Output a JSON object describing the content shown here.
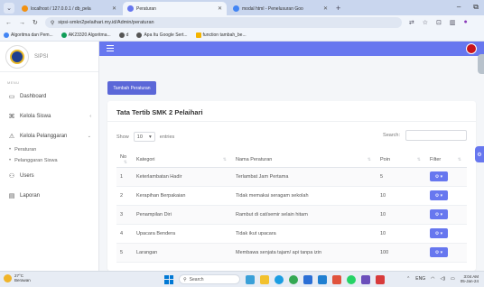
{
  "browser": {
    "tabs": [
      {
        "title": "localhost / 127.0.0.1 / db_pela",
        "favicon_color": "#f29111",
        "active": false
      },
      {
        "title": "Peraturan",
        "favicon_color": "#6777ef",
        "active": true
      },
      {
        "title": "modal html - Penelusuran Goo",
        "favicon_color": "#4285f4",
        "active": false
      }
    ],
    "new_tab_label": "+",
    "window_controls": [
      "–",
      "⧉"
    ],
    "url": "sipsi-smkn2pelaihari.my.id/Admin/peraturan",
    "bookmarks": [
      {
        "label": "Algoritma dan Pem...",
        "color": "#4285f4"
      },
      {
        "label": "AK23320 Algoritma...",
        "color": "#0f9d58"
      },
      {
        "label": "d",
        "color": "#555555"
      },
      {
        "label": "Apa Itu Google Sert...",
        "color": "#555555"
      },
      {
        "label": "function tambah_be...",
        "color": "#f4b400"
      }
    ]
  },
  "sidebar": {
    "brand": "SIPSI",
    "menu_label": "MENU",
    "items": [
      {
        "icon": "monitor-icon",
        "glyph": "▭",
        "label": "Dashboard",
        "has_arrow": false
      },
      {
        "icon": "grid-icon",
        "glyph": "⌘",
        "label": "Kelola Siswa",
        "has_arrow": true,
        "arrow": "‹"
      },
      {
        "icon": "warning-icon",
        "glyph": "⚠",
        "label": "Kelola Pelanggaran",
        "has_arrow": true,
        "arrow": "⌄"
      }
    ],
    "subitems": [
      {
        "label": "Peraturan"
      },
      {
        "label": "Pelanggaran Siswa"
      }
    ],
    "items_after": [
      {
        "icon": "users-icon",
        "glyph": "⚇",
        "label": "Users"
      },
      {
        "icon": "report-icon",
        "glyph": "▤",
        "label": "Laporan"
      }
    ]
  },
  "toolbar": {
    "add_label": "Tambah Peraturan"
  },
  "card": {
    "title": "Tata Tertib SMK 2 Pelaihari",
    "show_label": "Show",
    "show_value": "10",
    "entries_label": "entries",
    "search_label": "Search:"
  },
  "table": {
    "headers": [
      "No",
      "Kategori",
      "Nama Peraturan",
      "Poin",
      "Filter"
    ],
    "rows": [
      {
        "no": "1",
        "kategori": "Keterlambatan Hadir",
        "nama": "Terlambat Jam Pertama",
        "poin": "5"
      },
      {
        "no": "2",
        "kategori": "Kerapihan Berpakaian",
        "nama": "Tidak memakai seragam sekolah",
        "poin": "10"
      },
      {
        "no": "3",
        "kategori": "Penampilan Diri",
        "nama": "Rambut di cat/semir selain hitam",
        "poin": "10"
      },
      {
        "no": "4",
        "kategori": "Upacara Bendera",
        "nama": "Tidak ikut upacara",
        "poin": "10"
      },
      {
        "no": "5",
        "kategori": "Larangan",
        "nama": "Membawa senjata tajam/ api tanpa izin",
        "poin": "100"
      }
    ],
    "filter_label": "⚙ ▾"
  },
  "taskbar": {
    "weather_temp": "27°C",
    "weather_desc": "Berawan",
    "search_placeholder": "Search",
    "lang": "ENG",
    "time": "3:04 AM",
    "date": "05-Jan-24"
  }
}
